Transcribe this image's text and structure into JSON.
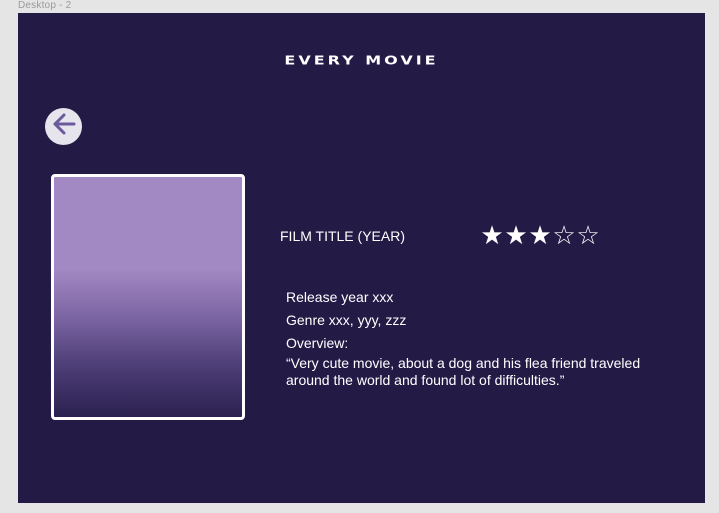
{
  "canvas": {
    "frame_label": "Desktop - 2"
  },
  "header": {
    "title": "EVERY MOVIE"
  },
  "nav": {
    "back_icon": "arrow-left-icon"
  },
  "movie": {
    "title": "FILM TITLE (YEAR)",
    "rating": 3,
    "rating_max": 5,
    "release": "Release year xxx",
    "genre": "Genre xxx, yyy, zzz",
    "overview_label": "Overview:",
    "overview": "“Very cute movie, about a dog and his flea friend traveled around the world and found lot of difficulties.”"
  },
  "colors": {
    "background": "#241a46",
    "canvas": "#e5e5e5",
    "poster_top": "#a389c4",
    "poster_bottom": "#2b2150",
    "text": "#ffffff",
    "button_bg": "#e6e4ec",
    "button_icon": "#6a5a9c"
  }
}
